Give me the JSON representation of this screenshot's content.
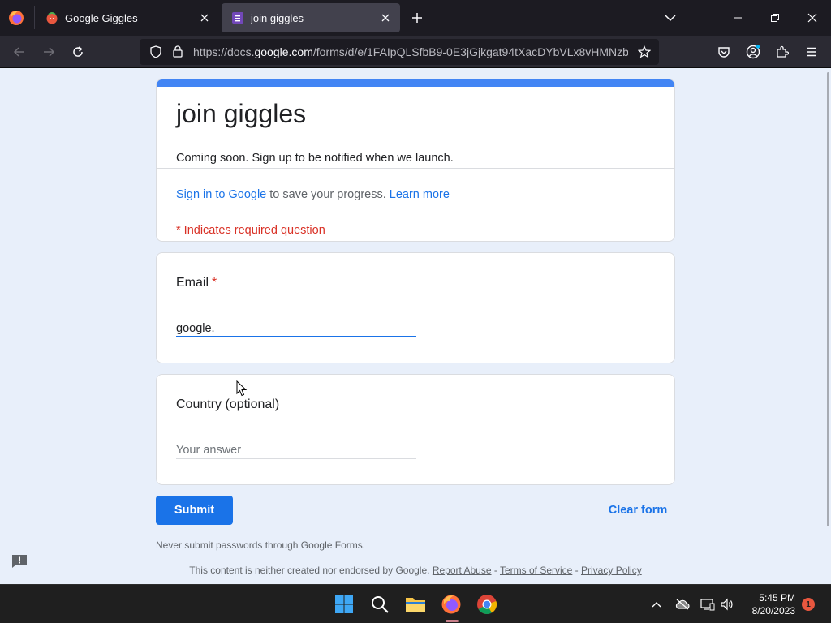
{
  "browser": {
    "tabs": [
      {
        "title": "Google Giggles",
        "active": false
      },
      {
        "title": "join giggles",
        "active": true
      }
    ],
    "url": {
      "prefix": "https://docs.",
      "domain": "google.com",
      "path": "/forms/d/e/1FAIpQLSfbB9-0E3jGjkgat94tXacDYbVLx8vHMNzb7..."
    }
  },
  "form": {
    "title": "join giggles",
    "description": "Coming soon. Sign up to be notified when we launch.",
    "signin_link": "Sign in to Google",
    "signin_rest": " to save your progress. ",
    "learn_more": "Learn more",
    "required_note": "* Indicates required question",
    "questions": [
      {
        "label": "Email",
        "required_mark": "*",
        "value": "google.",
        "placeholder": ""
      },
      {
        "label": "Country (optional)",
        "value": "",
        "placeholder": "Your answer"
      }
    ],
    "submit_label": "Submit",
    "clear_label": "Clear form",
    "password_note": "Never submit passwords through Google Forms.",
    "footer": {
      "text": "This content is neither created nor endorsed by Google. ",
      "report_abuse": "Report Abuse",
      "sep": " - ",
      "terms": "Terms of Service",
      "privacy": "Privacy Policy"
    }
  },
  "taskbar": {
    "time": "5:45 PM",
    "date": "8/20/2023",
    "notification_count": "1"
  },
  "colors": {
    "accent": "#1a73e8",
    "header_bar": "#4285f4",
    "required": "#d93025",
    "page_bg": "#e8effa"
  }
}
